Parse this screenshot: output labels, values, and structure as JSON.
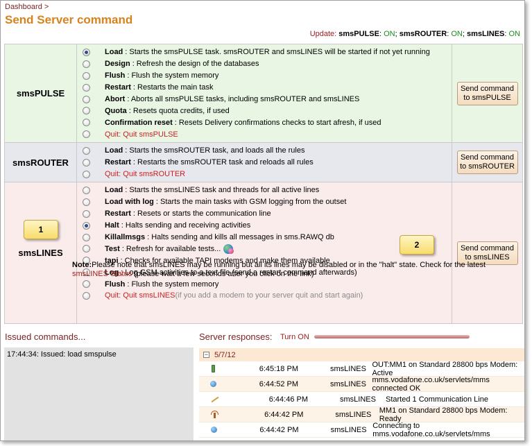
{
  "breadcrumb": {
    "link": "Dashboard",
    "sep": ">"
  },
  "title": "Send Server command",
  "update": {
    "label": "Update:",
    "items": [
      {
        "name": "smsPULSE",
        "sep": ":",
        "state": "ON",
        "end": ";"
      },
      {
        "name": "smsROUTER",
        "sep": ":",
        "state": "ON",
        "end": ";"
      },
      {
        "name": "smsLINES",
        "sep": ":",
        "state": "ON",
        "end": ""
      }
    ]
  },
  "sections": [
    {
      "name": "smsPULSE",
      "button": "Send command to smsPULSE",
      "commands": [
        {
          "label": "Load",
          "desc": ": Starts the smsPULSE task.  smsROUTER and smsLINES will be started if not yet running",
          "checked": true
        },
        {
          "label": "Design",
          "desc": ": Refresh the design of the databases",
          "checked": false
        },
        {
          "label": "Flush",
          "desc": ": Flush the system memory",
          "checked": false
        },
        {
          "label": "Restart",
          "desc": ": Restarts the main task",
          "checked": false
        },
        {
          "label": "Abort",
          "desc": ": Aborts all smsPULSE tasks, including smsROUTER and smsLINES",
          "checked": false
        },
        {
          "label": "Quota",
          "desc": ": Resets quota credits, if used",
          "checked": false
        },
        {
          "label": "Confirmation reset",
          "desc": ": Resets Delivery confirmations checks to start afresh, if used",
          "checked": false
        },
        {
          "label": "",
          "desc": "",
          "quit": "Quit: Quit smsPULSE",
          "checked": false
        }
      ]
    },
    {
      "name": "smsROUTER",
      "button": "Send command to smsROUTER",
      "commands": [
        {
          "label": "Load",
          "desc": ": Starts the smsROUTER task, and loads all the rules",
          "checked": false
        },
        {
          "label": "Restart",
          "desc": ": Restarts the smsROUTER task and reloads all rules",
          "checked": false
        },
        {
          "label": "",
          "desc": "",
          "quit": "Quit: Quit smsROUTER",
          "checked": false
        }
      ]
    },
    {
      "name": "smsLINES",
      "button": "Send command to smsLINES",
      "commands": [
        {
          "label": "Load",
          "desc": ": Starts the smsLINES task and threads for all active lines",
          "checked": false
        },
        {
          "label": "Load with log",
          "desc": ": Starts the main tasks with GSM logging from the outset",
          "checked": false
        },
        {
          "label": "Restart",
          "desc": ": Resets or starts the communication line",
          "checked": false
        },
        {
          "label": "Halt",
          "desc": ": Halts sending and receiving activities",
          "checked": true
        },
        {
          "label": "Killallmsgs",
          "desc": ": Halts sending and kills all messages in sms.RAWQ db",
          "checked": false
        },
        {
          "label": "Test",
          "desc": ": Refresh for available tests...",
          "checked": false,
          "globe": true
        },
        {
          "label": "tapi",
          "desc": ": Checks for available TAPI modems and make them available",
          "checked": false
        },
        {
          "label": "Log",
          "desc": ": Log GSM activities to a text file (send a restart command afterwards)",
          "checked": false
        },
        {
          "label": "Flush",
          "desc": ": Flush the system memory",
          "checked": false
        },
        {
          "label": "",
          "desc": "",
          "quit": "Quit: Quit smsLINES",
          "quitNote": " (if you add a modem to your server quit and start again)",
          "checked": false
        }
      ]
    }
  ],
  "note": {
    "label": "Note:",
    "text": "Please note that smsLINES may be running but all its lines may be disabled or in the \"halt\" state.  Check for the latest ",
    "link": "smsLINES Status",
    "after": " (please wait a few seconds after you click on the link)"
  },
  "callouts": [
    {
      "text": "1"
    },
    {
      "text": "2"
    }
  ],
  "issued": {
    "title": "Issued commands...",
    "lines": [
      "17:44:34: Issued: load smspulse"
    ]
  },
  "responses": {
    "title": "Server responses:",
    "turn_on": "Turn ON",
    "date": "5/7/12",
    "toggle": "−",
    "rows": [
      {
        "icon": "battery-icon",
        "time": "6:45:18 PM",
        "source": "smsLINES",
        "message": "OUT:MM1 on Standard 28800 bps Modem: Active"
      },
      {
        "icon": "network-globe-icon",
        "time": "6:44:52 PM",
        "source": "smsLINES",
        "message": "mms.vodafone.co.uk/servlets/mms connected OK"
      },
      {
        "icon": "line-start-icon",
        "time": "6:44:46 PM",
        "source": "smsLINES",
        "message": "Started 1 Communication Line"
      },
      {
        "icon": "antenna-icon",
        "time": "6:44:42 PM",
        "source": "smsLINES",
        "message": "MM1 on Standard 28800 bps Modem: Ready"
      },
      {
        "icon": "network-globe-icon",
        "time": "6:44:42 PM",
        "source": "smsLINES",
        "message": "Connecting to mms.vodafone.co.uk/servlets/mms"
      }
    ]
  },
  "colors": {
    "title": "#d8821e",
    "link": "#7a1f1f",
    "on": "#1b8a1b",
    "quit": "#cc1f1f",
    "pulse_bg": "#e8f6e3",
    "router_bg": "#e6e8ee",
    "lines_bg": "#fbecec"
  }
}
